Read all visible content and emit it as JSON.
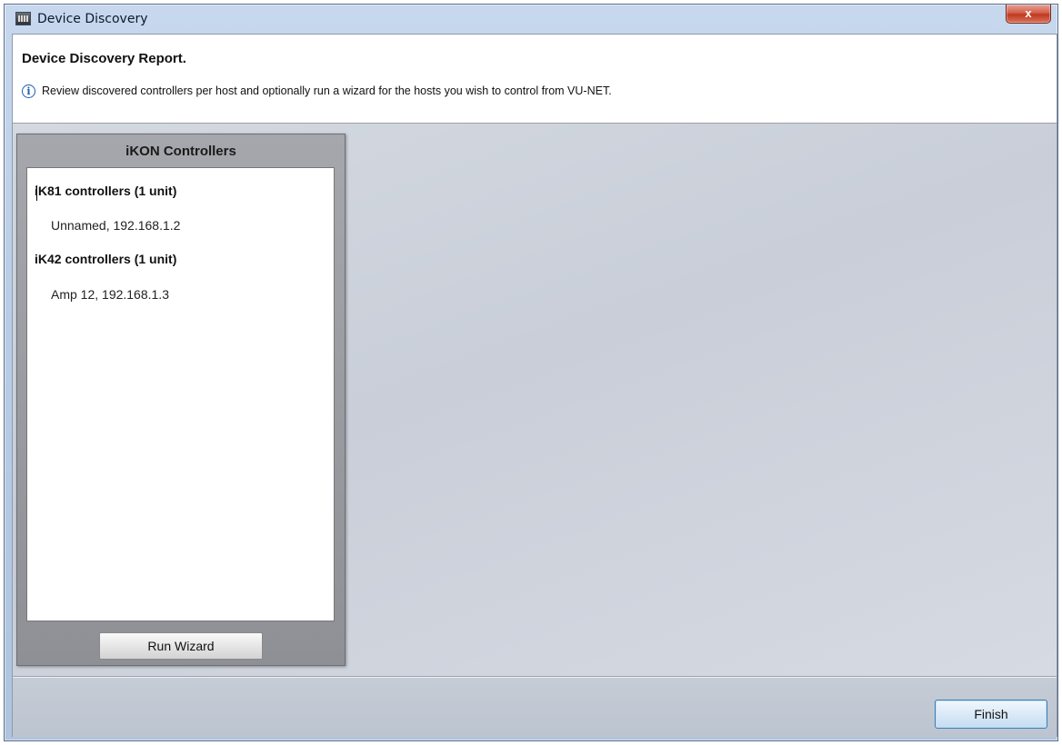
{
  "window": {
    "title": "Device Discovery",
    "close_label": "x"
  },
  "header": {
    "title": "Device Discovery Report.",
    "info_icon": "info-icon",
    "info_text": "Review discovered controllers per host and optionally run a wizard for the hosts you wish to control from VU-NET."
  },
  "panel": {
    "title": "iKON Controllers",
    "groups": [
      {
        "header": "iK81 controllers (1 unit)",
        "items": [
          "Unnamed, 192.168.1.2"
        ]
      },
      {
        "header": "iK42 controllers (1 unit)",
        "items": [
          "Amp 12, 192.168.1.3"
        ]
      }
    ],
    "run_wizard_label": "Run Wizard"
  },
  "footer": {
    "finish_label": "Finish"
  }
}
